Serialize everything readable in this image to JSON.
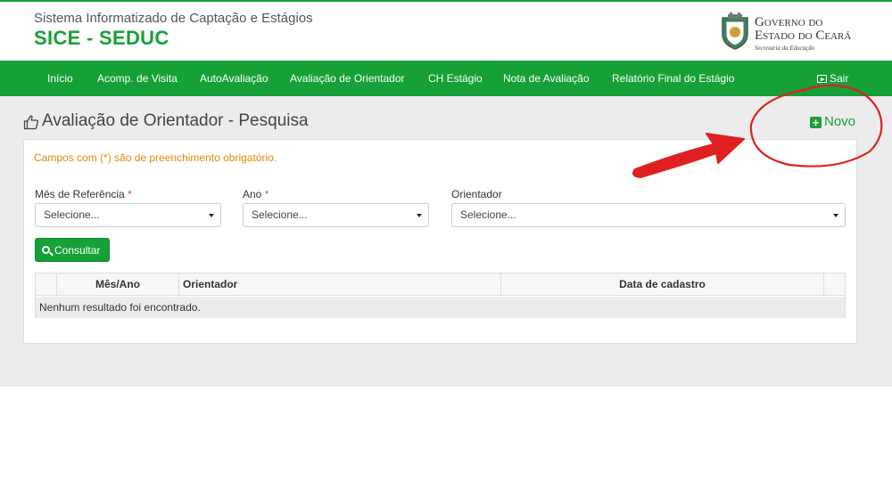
{
  "header": {
    "system_title": "Sistema Informatizado de Captação e Estágios",
    "system_name": "SICE - SEDUC",
    "gov_line1": "Governo do",
    "gov_line2": "Estado do Ceará",
    "gov_line3": "Secretaria da Educação"
  },
  "nav": {
    "items": [
      {
        "label": "Início"
      },
      {
        "label": "Acomp. de Visita"
      },
      {
        "label": "AutoAvaliação"
      },
      {
        "label": "Avaliação de Orientador"
      },
      {
        "label": "CH Estágio"
      },
      {
        "label": "Nota de Avaliação"
      },
      {
        "label": "Relatório Final do Estágio"
      }
    ],
    "logout_label": "Sair"
  },
  "page": {
    "title": "Avaliação de Orientador - Pesquisa",
    "new_button_label": "Novo",
    "required_note": "Campos com (*) são de preenchimento obrigatório."
  },
  "filters": {
    "month": {
      "label": "Mês de Referência",
      "required_mark": "*",
      "value": "Selecione..."
    },
    "year": {
      "label": "Ano",
      "required_mark": "*",
      "value": "Selecione..."
    },
    "advisor": {
      "label": "Orientador",
      "value": "Selecione..."
    }
  },
  "search_button_label": "Consultar",
  "table": {
    "columns": [
      "",
      "Mês/Ano",
      "Orientador",
      "Data de cadastro",
      ""
    ],
    "empty_message": "Nenhum resultado foi encontrado."
  },
  "colors": {
    "brand_green": "#16a038",
    "warning_orange": "#e08a0b",
    "annotation_red": "#e02020"
  }
}
